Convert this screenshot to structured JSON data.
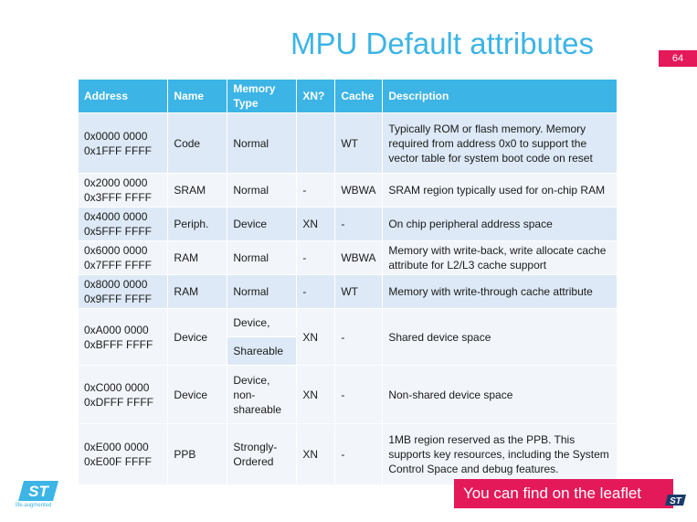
{
  "slide": {
    "title": "MPU Default attributes",
    "page_number": "64"
  },
  "table": {
    "headers": {
      "address": "Address",
      "name": "Name",
      "memory_type": "Memory Type",
      "xn": "XN?",
      "cache": "Cache",
      "description": "Description"
    },
    "rows": [
      {
        "address_start": "0x0000 0000",
        "address_end": "0x1FFF FFFF",
        "name": "Code",
        "memory_type": "Normal",
        "xn": "",
        "cache": "WT",
        "description": "Typically ROM or flash memory. Memory required from address 0x0 to support the vector table for system boot code on reset"
      },
      {
        "address_start": "0x2000 0000",
        "address_end": "0x3FFF FFFF",
        "name": "SRAM",
        "memory_type": "Normal",
        "xn": "-",
        "cache": "WBWA",
        "description": "SRAM region typically used for on-chip RAM"
      },
      {
        "address_start": "0x4000 0000",
        "address_end": "0x5FFF FFFF",
        "name": "Periph.",
        "memory_type": "Device",
        "xn": "XN",
        "cache": "-",
        "description": "On chip peripheral address space"
      },
      {
        "address_start": "0x6000 0000",
        "address_end": "0x7FFF FFFF",
        "name": "RAM",
        "memory_type": "Normal",
        "xn": "-",
        "cache": "WBWA",
        "description": "Memory with write-back, write allocate cache attribute for L2/L3 cache support"
      },
      {
        "address_start": "0x8000 0000",
        "address_end": "0x9FFF FFFF",
        "name": "RAM",
        "memory_type": "Normal",
        "xn": "-",
        "cache": "WT",
        "description": "Memory with write-through cache attribute"
      },
      {
        "address_start": "0xA000 0000",
        "address_end": "0xBFFF FFFF",
        "name": "Device",
        "memory_type_line1": "Device,",
        "memory_type_line2": "Shareable",
        "xn": "XN",
        "cache": "-",
        "description": "Shared device space"
      },
      {
        "address_start": "0xC000 0000",
        "address_end": "0xDFFF FFFF",
        "name": "Device",
        "memory_type_line1": "Device,",
        "memory_type_line2": "non-shareable",
        "xn": "XN",
        "cache": "-",
        "description": "Non-shared device space"
      },
      {
        "address_start": "0xE000 0000",
        "address_end": "0xE00F FFFF",
        "name": "PPB",
        "memory_type": "Strongly-Ordered",
        "xn": "XN",
        "cache": "-",
        "description": "1MB region reserved as the PPB. This supports key resources, including the System Control Space and debug features."
      }
    ]
  },
  "branding": {
    "logo_tagline": "life.augmented",
    "leaflet_banner": "You can find on the leaflet"
  },
  "colors": {
    "accent": "#3cb4e6",
    "highlight": "#e4195a",
    "row_band": "#dde9f6",
    "row_plain": "#f2f6fb"
  }
}
